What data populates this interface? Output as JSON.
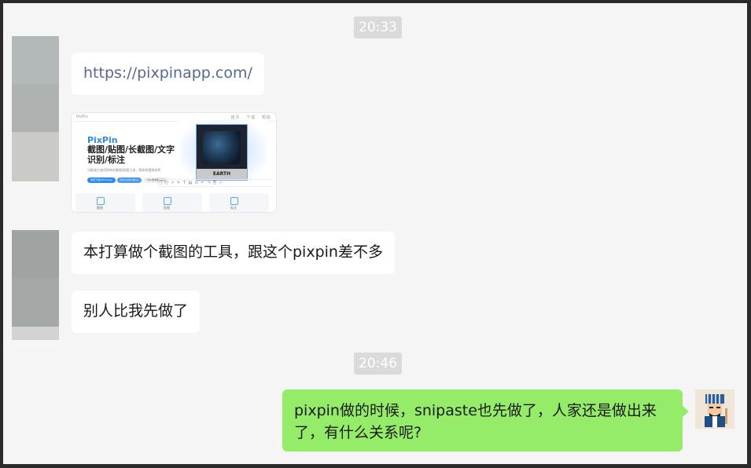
{
  "timestamps": [
    "20:33",
    "20:46"
  ],
  "messages": {
    "link": "https://pixpinapp.com/",
    "msg1": "本打算做个截图的工具，跟这个pixpin差不多",
    "msg2": "别人比我先做了",
    "reply": "pixpin做的时候，snipaste也先做了，人家还是做出来了，有什么关系呢?"
  },
  "link_card": {
    "brand": "PixPin",
    "nav_links": "首页 · 下载 · 帮助",
    "title": "PixPin",
    "headline_line1": "截图/贴图/长截图/文字",
    "headline_line2": "识别/标注",
    "subtitle": "功能强大使用简单的截图/贴图工具，帮助你提高效率",
    "buttons": [
      "免费下载(Windows)",
      "Microsoft Store",
      "Mac版本即将推出"
    ],
    "shot_label": "EARTH",
    "features": [
      "截图",
      "贴图",
      "标注"
    ],
    "colors": {
      "accent": "#2f8bea"
    }
  },
  "colors": {
    "bubble_green": "#95ec69",
    "link": "#57698e"
  }
}
